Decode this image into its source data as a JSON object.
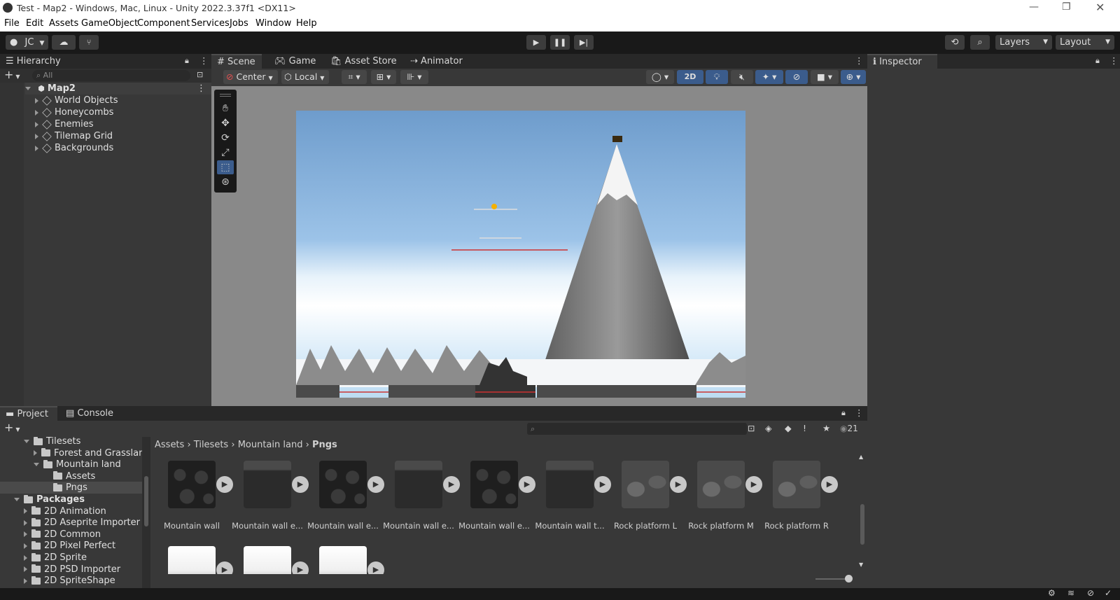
{
  "window": {
    "title": "Test - Map2 - Windows, Mac, Linux - Unity 2022.3.37f1 <DX11>"
  },
  "menu": [
    "File",
    "Edit",
    "Assets",
    "GameObject",
    "Component",
    "Services",
    "Jobs",
    "Window",
    "Help"
  ],
  "toolbar": {
    "account": "JC",
    "layers": "Layers",
    "layout": "Layout"
  },
  "hierarchy": {
    "tab": "Hierarchy",
    "search_placeholder": "All",
    "scene": "Map2",
    "items": [
      "World Objects",
      "Honeycombs",
      "Enemies",
      "Tilemap Grid",
      "Backgrounds"
    ]
  },
  "scene_tabs": [
    "Scene",
    "Game",
    "Asset Store",
    "Animator"
  ],
  "scene_toolbar": {
    "pivot": "Center",
    "space": "Local",
    "mode2d": "2D"
  },
  "inspector": {
    "tab": "Inspector"
  },
  "project": {
    "tabs": [
      "Project",
      "Console"
    ],
    "tree": [
      {
        "label": "Tilesets",
        "depth": 1,
        "expanded": true
      },
      {
        "label": "Forest and Grassland",
        "depth": 2,
        "expanded": false
      },
      {
        "label": "Mountain land",
        "depth": 2,
        "expanded": true
      },
      {
        "label": "Assets",
        "depth": 3,
        "expanded": null
      },
      {
        "label": "Pngs",
        "depth": 3,
        "expanded": null,
        "selected": true
      },
      {
        "label": "Packages",
        "depth": 0,
        "expanded": true,
        "bold": true
      },
      {
        "label": "2D Animation",
        "depth": 1,
        "expanded": false
      },
      {
        "label": "2D Aseprite Importer",
        "depth": 1,
        "expanded": false
      },
      {
        "label": "2D Common",
        "depth": 1,
        "expanded": false
      },
      {
        "label": "2D Pixel Perfect",
        "depth": 1,
        "expanded": false
      },
      {
        "label": "2D Sprite",
        "depth": 1,
        "expanded": false
      },
      {
        "label": "2D PSD Importer",
        "depth": 1,
        "expanded": false
      },
      {
        "label": "2D SpriteShape",
        "depth": 1,
        "expanded": false
      }
    ],
    "breadcrumb": [
      "Assets",
      "Tilesets",
      "Mountain land",
      "Pngs"
    ],
    "hidden_count": "21",
    "assets": [
      {
        "label": "Mountain wall",
        "tex": "rock"
      },
      {
        "label": "Mountain wall e...",
        "tex": "edge"
      },
      {
        "label": "Mountain wall e...",
        "tex": "rock"
      },
      {
        "label": "Mountain wall e...",
        "tex": "edge"
      },
      {
        "label": "Mountain wall e...",
        "tex": "rock"
      },
      {
        "label": "Mountain wall t...",
        "tex": "edge"
      },
      {
        "label": "Rock platform L",
        "tex": "plat"
      },
      {
        "label": "Rock platform M",
        "tex": "plat"
      },
      {
        "label": "Rock platform R",
        "tex": "plat"
      },
      {
        "label": "",
        "tex": "snow"
      },
      {
        "label": "",
        "tex": "snow"
      },
      {
        "label": "",
        "tex": "snow"
      }
    ]
  }
}
